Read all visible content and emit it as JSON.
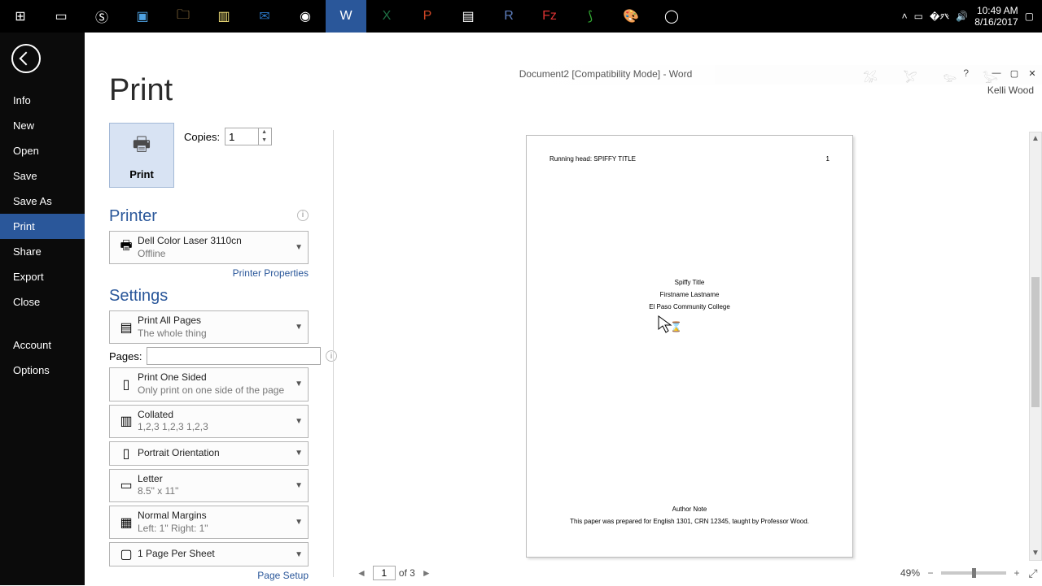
{
  "taskbar": {
    "clock_time": "10:49 AM",
    "clock_date": "8/16/2017"
  },
  "window": {
    "title": "Document2 [Compatibility Mode] - Word",
    "user": "Kelli Wood"
  },
  "sidebar": {
    "items": [
      {
        "label": "Info"
      },
      {
        "label": "New"
      },
      {
        "label": "Open"
      },
      {
        "label": "Save"
      },
      {
        "label": "Save As"
      },
      {
        "label": "Print"
      },
      {
        "label": "Share"
      },
      {
        "label": "Export"
      },
      {
        "label": "Close"
      },
      {
        "label": "Account"
      },
      {
        "label": "Options"
      }
    ],
    "active_index": 5
  },
  "print": {
    "heading": "Print",
    "print_label": "Print",
    "copies_label": "Copies:",
    "copies_value": "1",
    "printer_heading": "Printer",
    "printer_name": "Dell Color Laser 3110cn",
    "printer_status": "Offline",
    "printer_properties": "Printer Properties",
    "settings_heading": "Settings",
    "settings": {
      "pages_range": {
        "primary": "Print All Pages",
        "secondary": "The whole thing"
      },
      "pages_label": "Pages:",
      "pages_value": "",
      "sides": {
        "primary": "Print One Sided",
        "secondary": "Only print on one side of the page"
      },
      "collate": {
        "primary": "Collated",
        "secondary": "1,2,3    1,2,3    1,2,3"
      },
      "orientation": {
        "primary": "Portrait Orientation",
        "secondary": ""
      },
      "paper": {
        "primary": "Letter",
        "secondary": "8.5\" x 11\""
      },
      "margins": {
        "primary": "Normal Margins",
        "secondary": "Left:  1\"    Right:  1\""
      },
      "per_sheet": {
        "primary": "1 Page Per Sheet",
        "secondary": ""
      }
    },
    "page_setup": "Page Setup"
  },
  "preview": {
    "running_head": "Running head: SPIFFY TITLE",
    "page_num": "1",
    "title": "Spiffy Title",
    "author": "Firstname Lastname",
    "school": "El Paso Community College",
    "author_note": "Author Note",
    "note_text": "This paper was prepared for English 1301, CRN 12345, taught by Professor Wood."
  },
  "footer": {
    "current_page": "1",
    "of_label": "of 3",
    "zoom": "49%"
  }
}
